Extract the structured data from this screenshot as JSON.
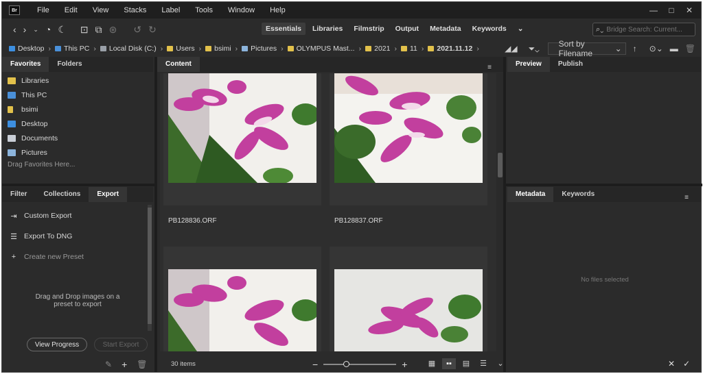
{
  "app": {
    "logo": "Br"
  },
  "menu": [
    "File",
    "Edit",
    "View",
    "Stacks",
    "Label",
    "Tools",
    "Window",
    "Help"
  ],
  "window_controls": {
    "minimize": "—",
    "maximize": "□",
    "close": "✕"
  },
  "workspaces": {
    "items": [
      "Essentials",
      "Libraries",
      "Filmstrip",
      "Output",
      "Metadata",
      "Keywords"
    ],
    "active": "Essentials",
    "more": "⌄"
  },
  "search": {
    "icon": "search-icon",
    "placeholder": "Bridge Search: Current..."
  },
  "breadcrumb": [
    "Desktop",
    "This PC",
    "Local Disk (C:)",
    "Users",
    "bsimi",
    "Pictures",
    "OLYMPUS Mast...",
    "2021",
    "11",
    "2021.11.12"
  ],
  "sort": {
    "label": "Sort by Filename"
  },
  "left_top_tabs": {
    "active": "Favorites",
    "other": "Folders"
  },
  "favorites": {
    "items": [
      {
        "label": "Libraries",
        "color": "#e2c14b"
      },
      {
        "label": "This PC",
        "color": "#4a90d9"
      },
      {
        "label": "bsimi",
        "color": "#e2c14b"
      },
      {
        "label": "Desktop",
        "color": "#3d8fe0"
      },
      {
        "label": "Documents",
        "color": "#c9ced6"
      },
      {
        "label": "Pictures",
        "color": "#8cb4dc"
      }
    ],
    "drag_hint": "Drag Favorites Here..."
  },
  "left_bottom_tabs": {
    "filter": "Filter",
    "collections": "Collections",
    "export": "Export",
    "active": "Export"
  },
  "export": {
    "items": [
      "Custom Export",
      "Export To DNG",
      "Create new Preset"
    ],
    "drag_note": "Drag and Drop images on a preset to export",
    "view_progress": "View Progress",
    "start_export": "Start Export"
  },
  "content": {
    "tab": "Content"
  },
  "thumbnails": [
    {
      "filename": "PB128836.ORF"
    },
    {
      "filename": "PB128837.ORF"
    },
    {
      "filename": ""
    },
    {
      "filename": ""
    }
  ],
  "status": {
    "item_count": "30 items",
    "zoom_level": 0.3
  },
  "right_top_tabs": {
    "active": "Preview",
    "other": "Publish"
  },
  "right_bottom_tabs": {
    "active": "Metadata",
    "other": "Keywords"
  },
  "metadata": {
    "empty_text": "No files selected"
  },
  "colors": {
    "bg": "#2b2b2b",
    "menubar": "#1f1f1f",
    "accent": "#e2c14b",
    "flower": "#c23f9e"
  }
}
